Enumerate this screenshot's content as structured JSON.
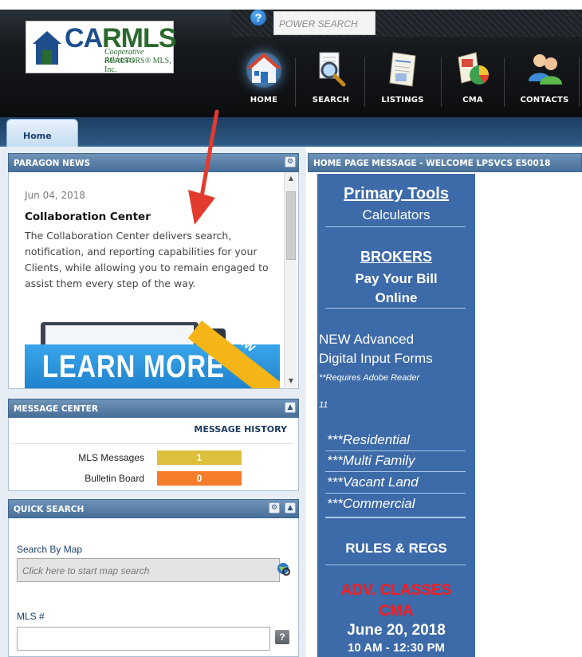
{
  "header": {
    "logo": {
      "brand_c": "C",
      "brand_a": "A",
      "brand_rest": "RMLS",
      "line1": "Cooperative Arkansas",
      "line2": "REALTORS® MLS, Inc."
    },
    "help_label": "?",
    "power_search_placeholder": "POWER SEARCH",
    "nav": [
      {
        "label": "HOME"
      },
      {
        "label": "SEARCH"
      },
      {
        "label": "LISTINGS"
      },
      {
        "label": "CMA"
      },
      {
        "label": "CONTACTS"
      }
    ]
  },
  "tabs": [
    {
      "label": "Home"
    }
  ],
  "news": {
    "header": "PARAGON NEWS",
    "date": "Jun 04, 2018",
    "title": "Collaboration Center",
    "body": "The Collaboration Center delivers search, notification, and reporting capabilities for your Clients, while allowing you to remain engaged to assist them every step of the way.",
    "banner_text": "LEARN MORE",
    "banner_badge": "NEW"
  },
  "message_center": {
    "header": "MESSAGE CENTER",
    "history_link": "MESSAGE HISTORY",
    "rows": [
      {
        "label": "MLS Messages",
        "count": "1",
        "color": "#dcbf3a"
      },
      {
        "label": "Bulletin Board",
        "count": "0",
        "color": "#f47c2a"
      }
    ]
  },
  "quick_search": {
    "header": "QUICK SEARCH",
    "map_label": "Search By Map",
    "map_placeholder": "Click here to start map search",
    "mls_label": "MLS #",
    "mls_help": "?"
  },
  "home_message": {
    "header": "HOME PAGE MESSAGE - WELCOME LPSVCS E50018",
    "primary_tools": "Primary Tools",
    "calculators": "Calculators",
    "brokers": "BROKERS",
    "pay_bill_1": "Pay Your Bill",
    "pay_bill_2": "Online",
    "new_forms_1": "NEW Advanced",
    "new_forms_2": "Digital Input Forms",
    "requires_1": "**Requires Adobe Reader",
    "requires_2": "11",
    "links": [
      "***Residential",
      "***Multi Family",
      "***Vacant Land",
      "***Commercial"
    ],
    "rules": "RULES & REGS",
    "adv_classes": "ADV. CLASSES",
    "cma": "CMA",
    "date": "June 20, 2018",
    "time": "10 AM - 12:30 PM"
  },
  "colors": {
    "accent_red": "#ff1a1a",
    "arrow_red": "#e23b2e",
    "promo_blue": "#3d6aa8"
  }
}
